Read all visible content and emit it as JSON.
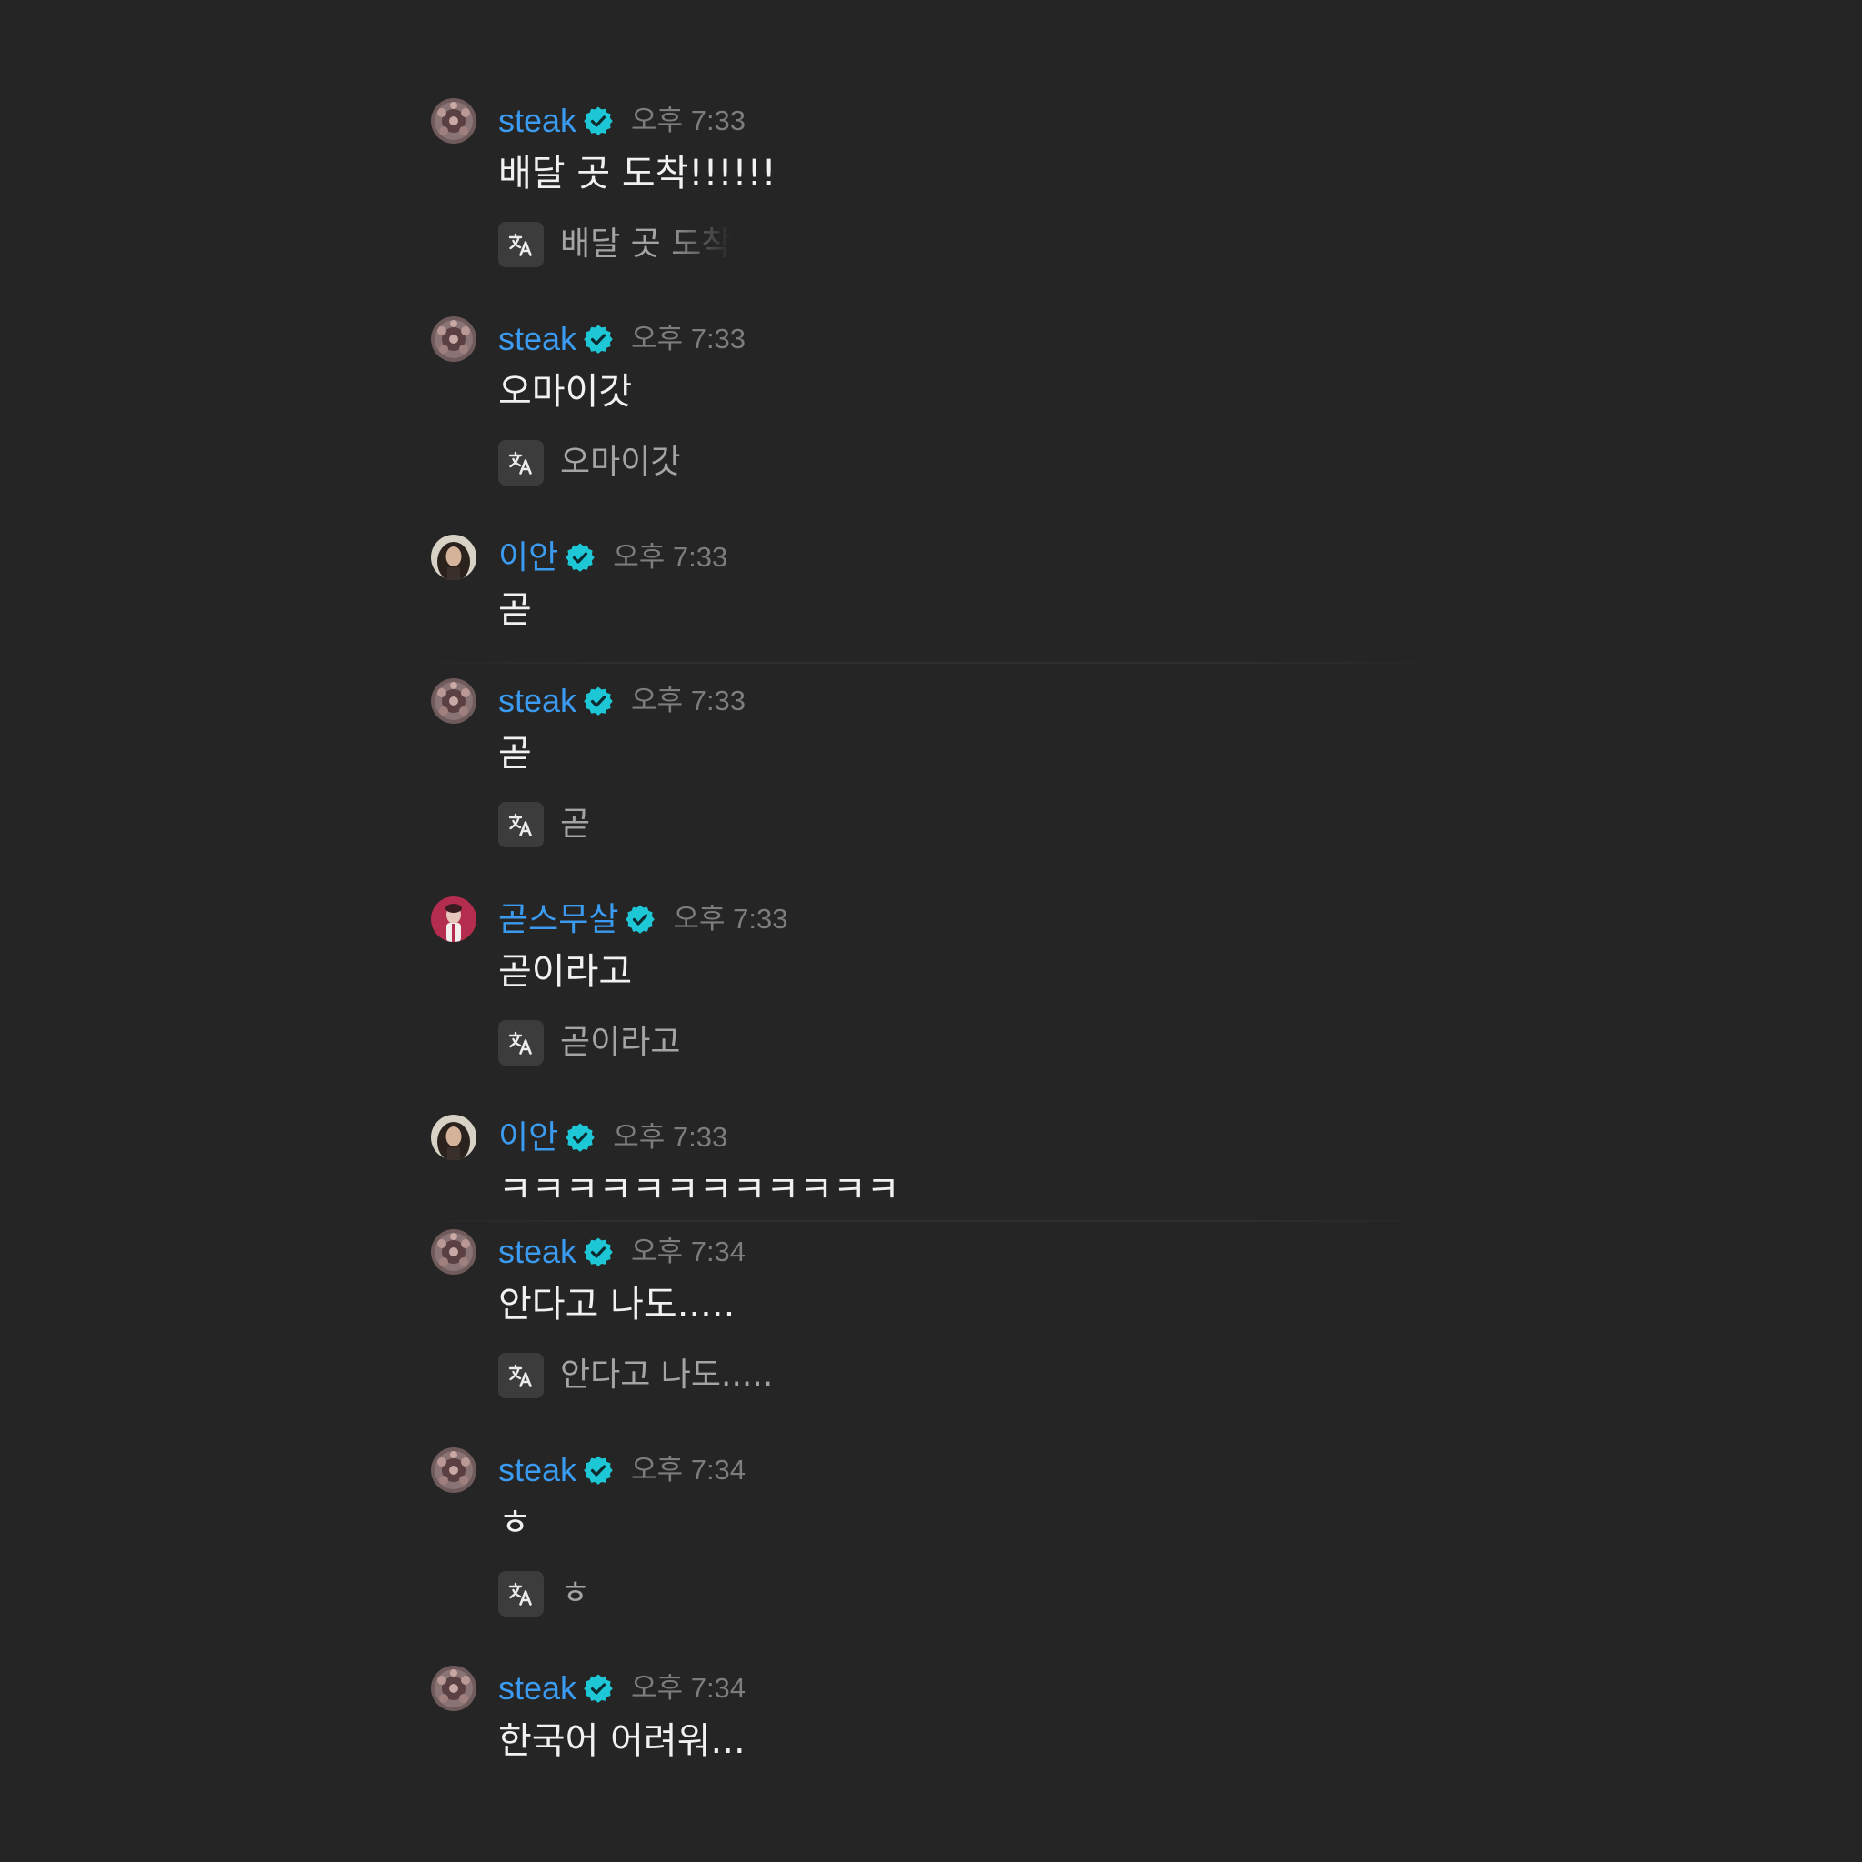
{
  "colors": {
    "background": "#252525",
    "username": "#3a9bf0",
    "verified_badge": "#1ec7d6",
    "timestamp": "#7d7d7d",
    "message_text": "#f1f1f1",
    "translation_text": "#a4a4a4",
    "translate_button_bg": "#3c3c3c"
  },
  "icons": {
    "verified": "verified-badge-icon",
    "translate": "translate-icon"
  },
  "messages": [
    {
      "user": "steak",
      "verified": true,
      "time": "오후 7:33",
      "text": "배달 곳 도착!!!!!!",
      "translation": "배달 곳 도착"
    },
    {
      "user": "steak",
      "verified": true,
      "time": "오후 7:33",
      "text": "오마이갓",
      "translation": "오마이갓"
    },
    {
      "user": "이안",
      "verified": true,
      "time": "오후 7:33",
      "text": "곧"
    },
    {
      "user": "steak",
      "verified": true,
      "time": "오후 7:33",
      "text": "곧",
      "translation": "곧"
    },
    {
      "user": "곧스무살",
      "verified": true,
      "time": "오후 7:33",
      "text": "곧이라고",
      "translation": "곧이라고"
    },
    {
      "user": "이안",
      "verified": true,
      "time": "오후 7:33",
      "text": "ㅋㅋㅋㅋㅋㅋㅋㅋㅋㅋㅋㅋ"
    },
    {
      "user": "steak",
      "verified": true,
      "time": "오후 7:34",
      "text": "안다고 나도.....",
      "translation": "안다고 나도....."
    },
    {
      "user": "steak",
      "verified": true,
      "time": "오후 7:34",
      "text": "ㅎ",
      "translation": "ㅎ"
    },
    {
      "user": "steak",
      "verified": true,
      "time": "오후 7:34",
      "text": "한국어 어려워..."
    }
  ]
}
